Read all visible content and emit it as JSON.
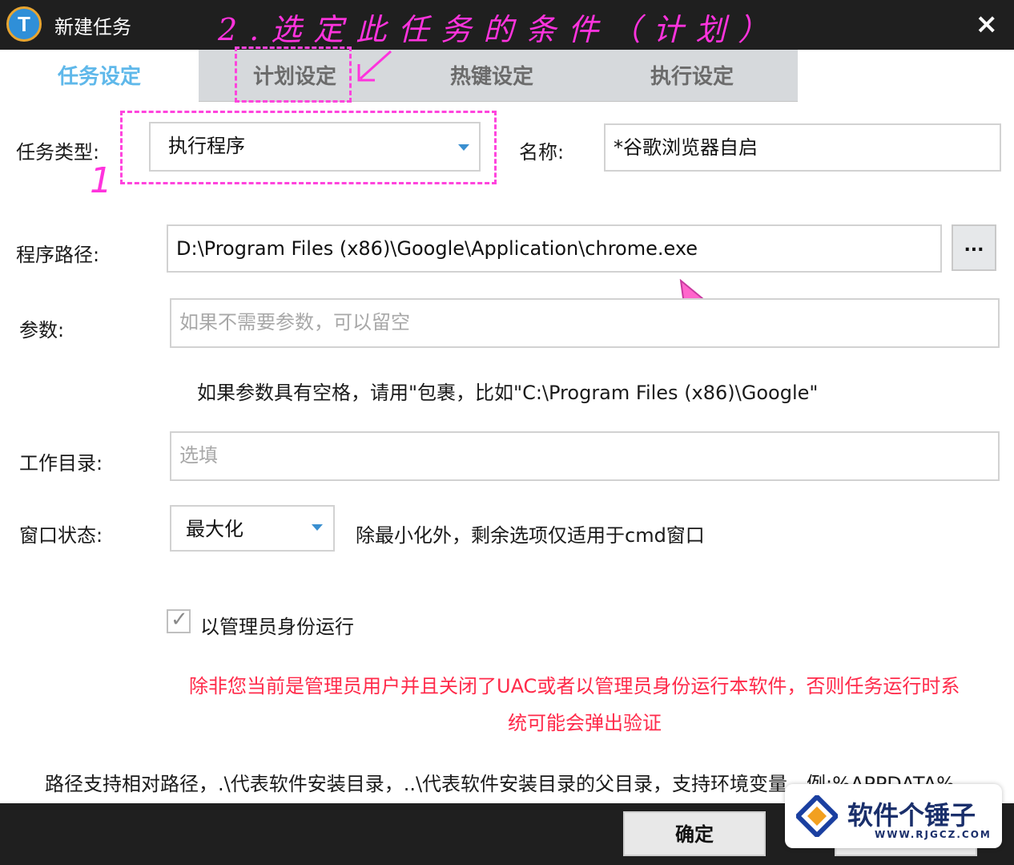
{
  "window": {
    "title": "新建任务",
    "logo_letter": "T",
    "close": "×"
  },
  "annotations": {
    "step2": "2.选定此任务的条件（计划）",
    "step1": "1"
  },
  "tabs": [
    {
      "label": "任务设定",
      "active": true
    },
    {
      "label": "计划设定",
      "active": false
    },
    {
      "label": "热键设定",
      "active": false
    },
    {
      "label": "执行设定",
      "active": false
    }
  ],
  "form": {
    "task_type": {
      "label": "任务类型:",
      "value": "执行程序"
    },
    "name": {
      "label": "名称:",
      "value": "*谷歌浏览器自启"
    },
    "program_path": {
      "label": "程序路径:",
      "value": "D:\\Program Files (x86)\\Google\\Application\\chrome.exe",
      "browse": "..."
    },
    "params": {
      "label": "参数:",
      "placeholder": "如果不需要参数，可以留空"
    },
    "params_hint": "如果参数具有空格，请用\"包裹，比如\"C:\\Program Files (x86)\\Google\"",
    "workdir": {
      "label": "工作目录:",
      "placeholder": "选填"
    },
    "window_state": {
      "label": "窗口状态:",
      "value": "最大化",
      "hint": "除最小化外，剩余选项仅适用于cmd窗口"
    },
    "run_as_admin": {
      "label": "以管理员身份运行",
      "checked": true
    }
  },
  "warning": {
    "line1": "除非您当前是管理员用户并且关闭了UAC或者以管理员身份运行本软件，否则任务运行时系",
    "line2": "统可能会弹出验证"
  },
  "footer_note": "路径支持相对路径，.\\代表软件安装目录，..\\代表软件安装目录的父目录，支持环境变量，例:%APPDATA%",
  "buttons": {
    "ok": "确定"
  },
  "watermark": {
    "text": "软件个锤子",
    "url": "WWW.RJGCZ.COM"
  },
  "colors": {
    "accent_tab": "#5fb8ea",
    "annotation": "#ff33dd",
    "warning": "#ff2a4a",
    "bar": "#1f1f1f"
  }
}
